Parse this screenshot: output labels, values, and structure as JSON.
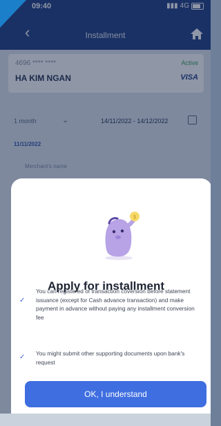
{
  "status_bar": {
    "time": "09:40",
    "network": "4G"
  },
  "header": {
    "title": "Installment",
    "back_icon": "chevron-left-icon",
    "home_icon": "home-icon"
  },
  "card": {
    "number": "4696 **** ****",
    "status": "Active",
    "holder_name": "HA KIM NGAN",
    "brand": "VISA"
  },
  "filter": {
    "period": "1 month",
    "date_range": "14/11/2022 - 14/12/2022",
    "calendar_icon": "calendar-icon"
  },
  "list": {
    "date_label": "11/11/2022",
    "merchant_label": "Merchant's name"
  },
  "sheet": {
    "title": "Apply for installment",
    "points": [
      "You can registered of transaction coversion before statement issuance (except for Cash advance transaction) and make payment in advance without paying any installment conversion fee",
      "You might submit other supporting documents upon bank's request"
    ],
    "check_icon": "check-icon",
    "confirm_label": "OK, I understand"
  },
  "colors": {
    "header": "#1f3f82",
    "accent": "#3f6ee0",
    "mascot": "#b7a3e6",
    "check": "#3b66d8"
  }
}
